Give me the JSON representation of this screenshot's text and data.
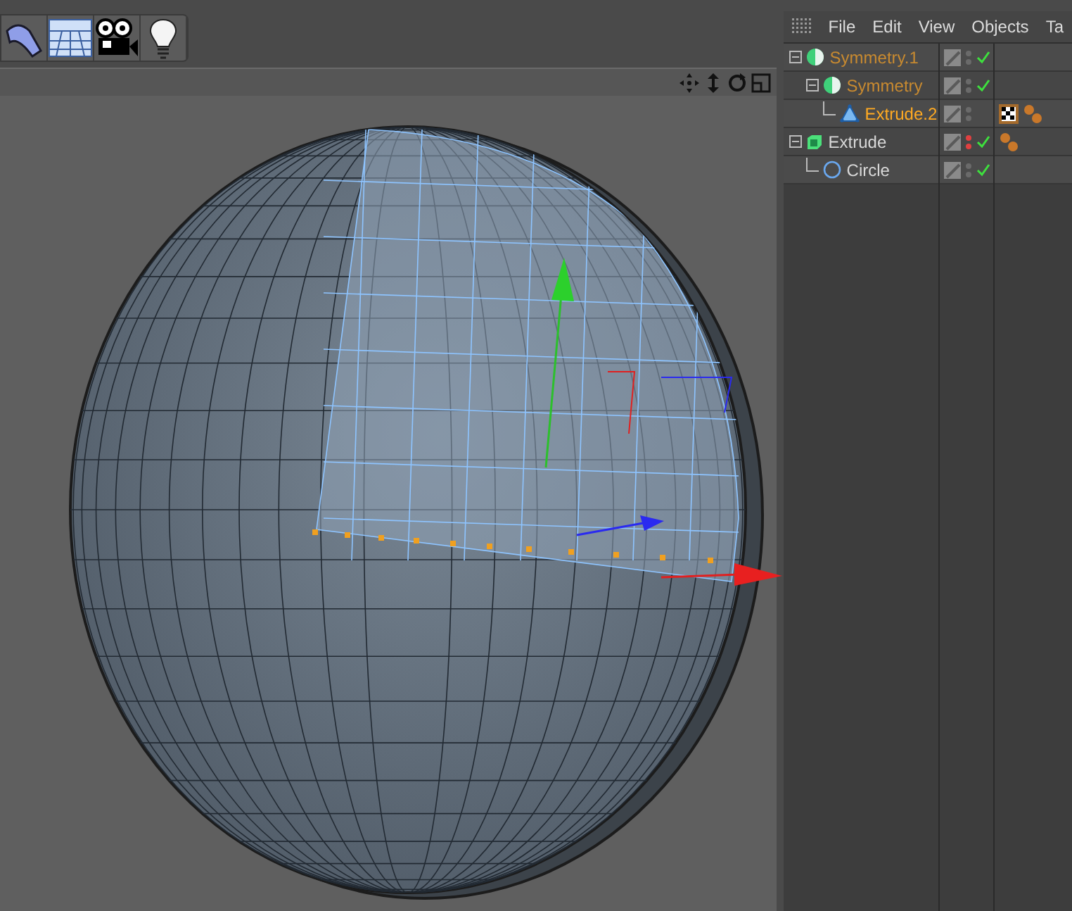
{
  "toolbar": {
    "tools": [
      {
        "kind": "bend"
      },
      {
        "kind": "floor"
      },
      {
        "kind": "camera"
      },
      {
        "kind": "light"
      }
    ]
  },
  "viewport": {
    "nav_icons": [
      {
        "kind": "move"
      },
      {
        "kind": "zoom"
      },
      {
        "kind": "rotate"
      },
      {
        "kind": "layout"
      }
    ]
  },
  "object_manager": {
    "menu": [
      "File",
      "Edit",
      "View",
      "Objects",
      "Ta"
    ],
    "objects": [
      {
        "name": "Symmetry.1",
        "kind": "symmetry",
        "selected": false,
        "highlighted": true,
        "visibility_forced": false,
        "enabled": true,
        "children": [
          {
            "name": "Symmetry",
            "kind": "symmetry",
            "selected": false,
            "highlighted": true,
            "visibility_forced": false,
            "enabled": true,
            "children": [
              {
                "name": "Extrude.2",
                "kind": "polygon",
                "selected": true,
                "highlighted": false,
                "visibility_forced": false,
                "enabled": false,
                "tags": [
                  {
                    "kind": "texture"
                  },
                  {
                    "kind": "phong"
                  }
                ]
              }
            ]
          }
        ]
      },
      {
        "name": "Extrude",
        "kind": "extrude",
        "selected": false,
        "highlighted": false,
        "visibility_forced": true,
        "enabled": true,
        "tags": [
          {
            "kind": "phong"
          }
        ],
        "children": [
          {
            "name": "Circle",
            "kind": "circle",
            "selected": false,
            "highlighted": false,
            "visibility_forced": false,
            "enabled": true
          }
        ]
      }
    ]
  }
}
